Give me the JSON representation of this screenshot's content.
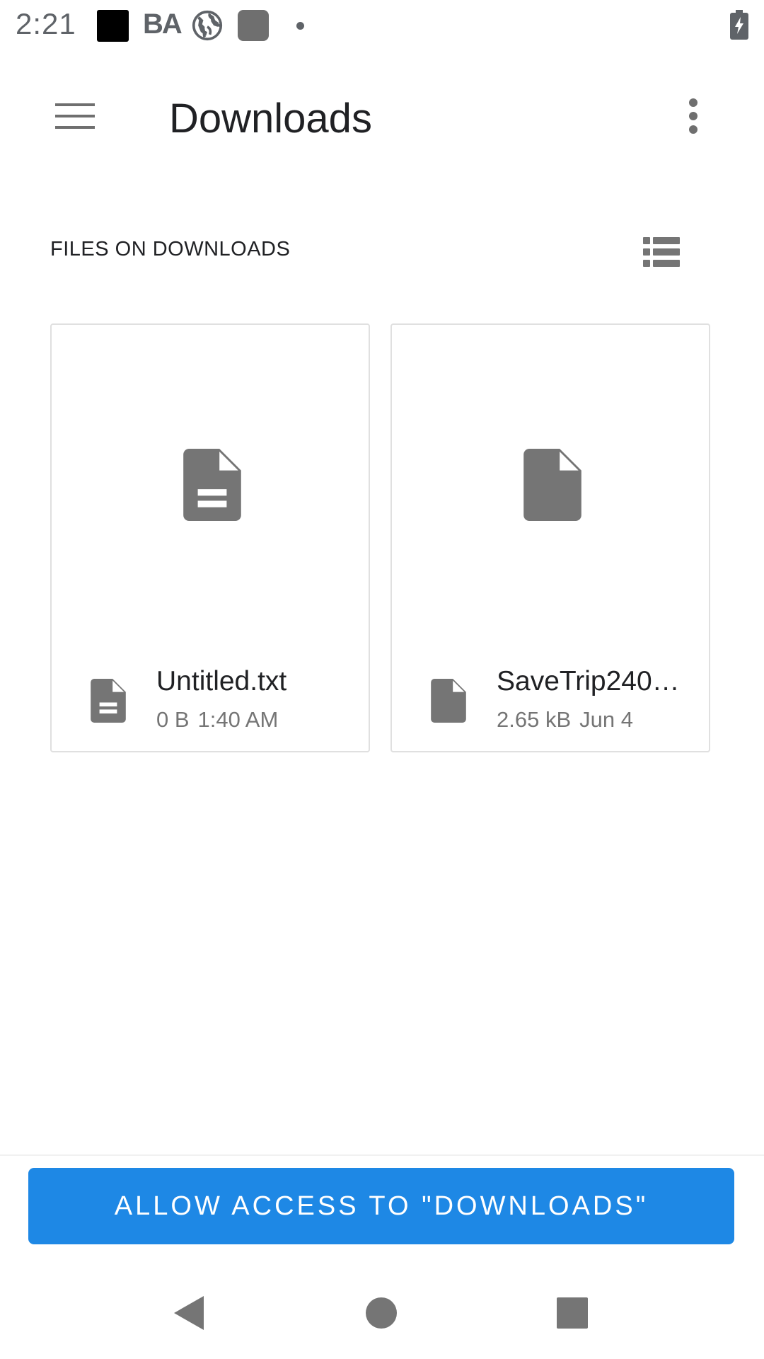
{
  "status_bar": {
    "time": "2:21",
    "notification_text_icon": "BA",
    "icons": [
      "black-square-icon",
      "ba-icon",
      "globe-icon",
      "gray-square-icon",
      "dot-icon",
      "battery-charging-icon"
    ]
  },
  "app_bar": {
    "title": "Downloads",
    "menu_icon": "hamburger-menu-icon",
    "overflow_icon": "more-vert-icon"
  },
  "section": {
    "header": "FILES ON DOWNLOADS",
    "view_toggle_icon": "list-view-icon"
  },
  "files": [
    {
      "name": "Untitled.txt",
      "size": "0 B",
      "date": "1:40 AM",
      "icon": "text-file-icon"
    },
    {
      "name": "SaveTrip240…",
      "size": "2.65 kB",
      "date": "Jun 4",
      "icon": "file-icon"
    }
  ],
  "action": {
    "allow_label": "ALLOW ACCESS TO \"DOWNLOADS\""
  },
  "nav_bar": {
    "icons": [
      "back-icon",
      "home-icon",
      "recents-icon"
    ]
  },
  "colors": {
    "accent": "#1e88e5",
    "icon_gray": "#757575",
    "text_primary": "#202124",
    "text_secondary": "#757575"
  }
}
